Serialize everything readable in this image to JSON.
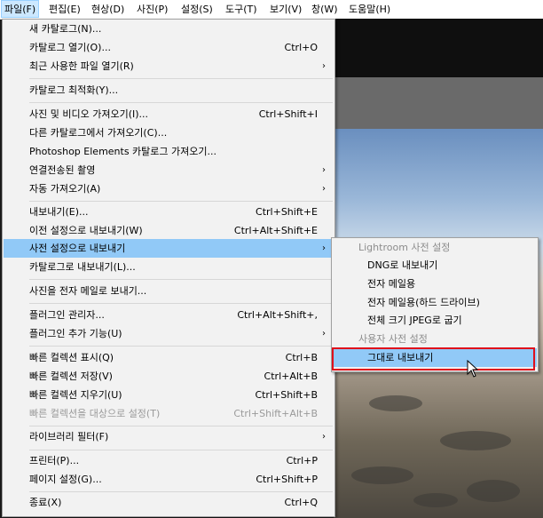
{
  "menubar": [
    "파일(F)",
    "편집(E)",
    "현상(D)",
    "사진(P)",
    "설정(S)",
    "도구(T)",
    "보기(V)",
    "창(W)",
    "도움말(H)"
  ],
  "file_menu": [
    {
      "label": "새 카탈로그(N)...",
      "shortcut": ""
    },
    {
      "label": "카탈로그 열기(O)...",
      "shortcut": "Ctrl+O"
    },
    {
      "label": "최근 사용한 파일 열기(R)",
      "shortcut": "",
      "submenu": true
    },
    {
      "label": "카탈로그 최적화(Y)...",
      "shortcut": ""
    },
    {
      "label": "사진 및 비디오 가져오기(I)...",
      "shortcut": "Ctrl+Shift+I"
    },
    {
      "label": "다른 카탈로그에서 가져오기(C)...",
      "shortcut": ""
    },
    {
      "label": "Photoshop Elements 카탈로그 가져오기...",
      "shortcut": ""
    },
    {
      "label": "연결전송된 촬영",
      "shortcut": "",
      "submenu": true
    },
    {
      "label": "자동 가져오기(A)",
      "shortcut": "",
      "submenu": true
    },
    {
      "label": "내보내기(E)...",
      "shortcut": "Ctrl+Shift+E"
    },
    {
      "label": "이전 설정으로 내보내기(W)",
      "shortcut": "Ctrl+Alt+Shift+E"
    },
    {
      "label": "사전 설정으로 내보내기",
      "shortcut": "",
      "submenu": true,
      "highlighted": true
    },
    {
      "label": "카탈로그로 내보내기(L)...",
      "shortcut": ""
    },
    {
      "label": "사진을 전자 메일로 보내기...",
      "shortcut": ""
    },
    {
      "label": "플러그인 관리자...",
      "shortcut": "Ctrl+Alt+Shift+,"
    },
    {
      "label": "플러그인 추가 기능(U)",
      "shortcut": "",
      "submenu": true
    },
    {
      "label": "빠른 컬렉션 표시(Q)",
      "shortcut": "Ctrl+B"
    },
    {
      "label": "빠른 컬렉션 저장(V)",
      "shortcut": "Ctrl+Alt+B"
    },
    {
      "label": "빠른 컬렉션 지우기(U)",
      "shortcut": "Ctrl+Shift+B"
    },
    {
      "label": "빠른 컬렉션을 대상으로 설정(T)",
      "shortcut": "Ctrl+Shift+Alt+B",
      "disabled": true
    },
    {
      "label": "라이브러리 필터(F)",
      "shortcut": "",
      "submenu": true
    },
    {
      "label": "프린터(P)...",
      "shortcut": "Ctrl+P"
    },
    {
      "label": "페이지 설정(G)...",
      "shortcut": "Ctrl+Shift+P"
    },
    {
      "label": "종료(X)",
      "shortcut": "Ctrl+Q"
    }
  ],
  "submenu_arrow": "›",
  "export_preset_submenu": [
    {
      "label": "Lightroom 사전 설정",
      "group": true
    },
    {
      "label": "DNG로 내보내기"
    },
    {
      "label": "전자 메일용"
    },
    {
      "label": "전자 메일용(하드 드라이브)"
    },
    {
      "label": "전체 크기 JPEG로 굽기"
    },
    {
      "label": "사용자 사전 설정",
      "group": true
    },
    {
      "label": "그대로 내보내기",
      "highlighted": true
    }
  ],
  "colors": {
    "highlight": "#91c9f7",
    "callout": "#e0101b",
    "menubar_open": "#cce8ff"
  },
  "icons": [
    "mouse-pointer-icon",
    "submenu-arrow-icon"
  ]
}
